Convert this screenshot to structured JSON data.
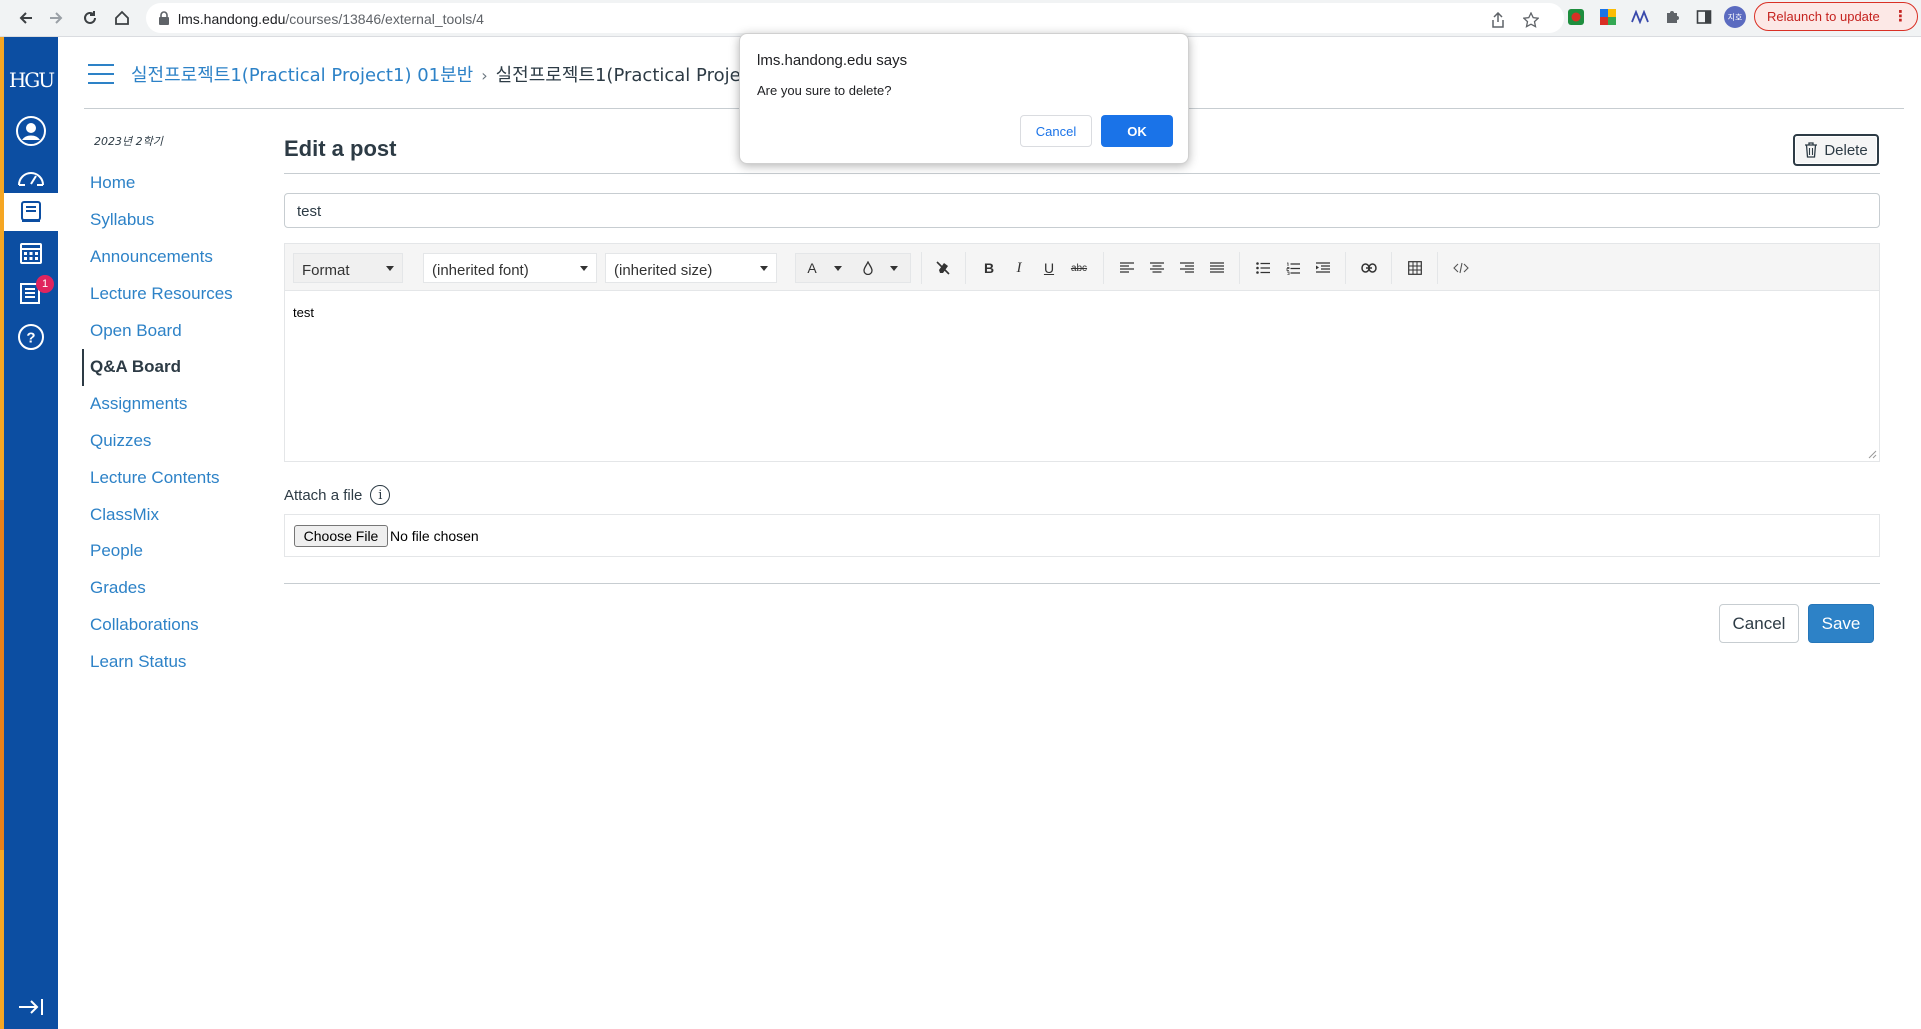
{
  "browser": {
    "url_host": "lms.handong.edu",
    "url_path": "/courses/13846/external_tools/4",
    "relaunch_label": "Relaunch to update",
    "profile_initials": "지호"
  },
  "global_nav": {
    "logo_text": "HGU",
    "inbox_badge": "1"
  },
  "breadcrumb": {
    "course": "실전프로젝트1(Practical Project1) 01분반",
    "current": "실전프로젝트1(Practical Project1"
  },
  "course_nav": {
    "term": "2023년 2학기",
    "items": [
      "Home",
      "Syllabus",
      "Announcements",
      "Lecture Resources",
      "Open Board",
      "Q&A Board",
      "Assignments",
      "Quizzes",
      "Lecture Contents",
      "ClassMix",
      "People",
      "Grades",
      "Collaborations",
      "Learn Status"
    ],
    "active_index": 5
  },
  "page": {
    "title": "Edit a post",
    "delete_label": "Delete",
    "subject_value": "test",
    "body_text": "test"
  },
  "toolbar": {
    "format_label": "Format",
    "font_label": "(inherited font)",
    "size_label": "(inherited size)",
    "font_color_label": "A",
    "bold": "B",
    "italic": "I",
    "underline": "U",
    "strike": "abc"
  },
  "attachment": {
    "label": "Attach a file",
    "choose_label": "Choose File",
    "status": "No file chosen"
  },
  "actions": {
    "cancel_label": "Cancel",
    "save_label": "Save"
  },
  "dialog": {
    "title": "lms.handong.edu says",
    "message": "Are you sure to delete?",
    "cancel_label": "Cancel",
    "ok_label": "OK"
  }
}
